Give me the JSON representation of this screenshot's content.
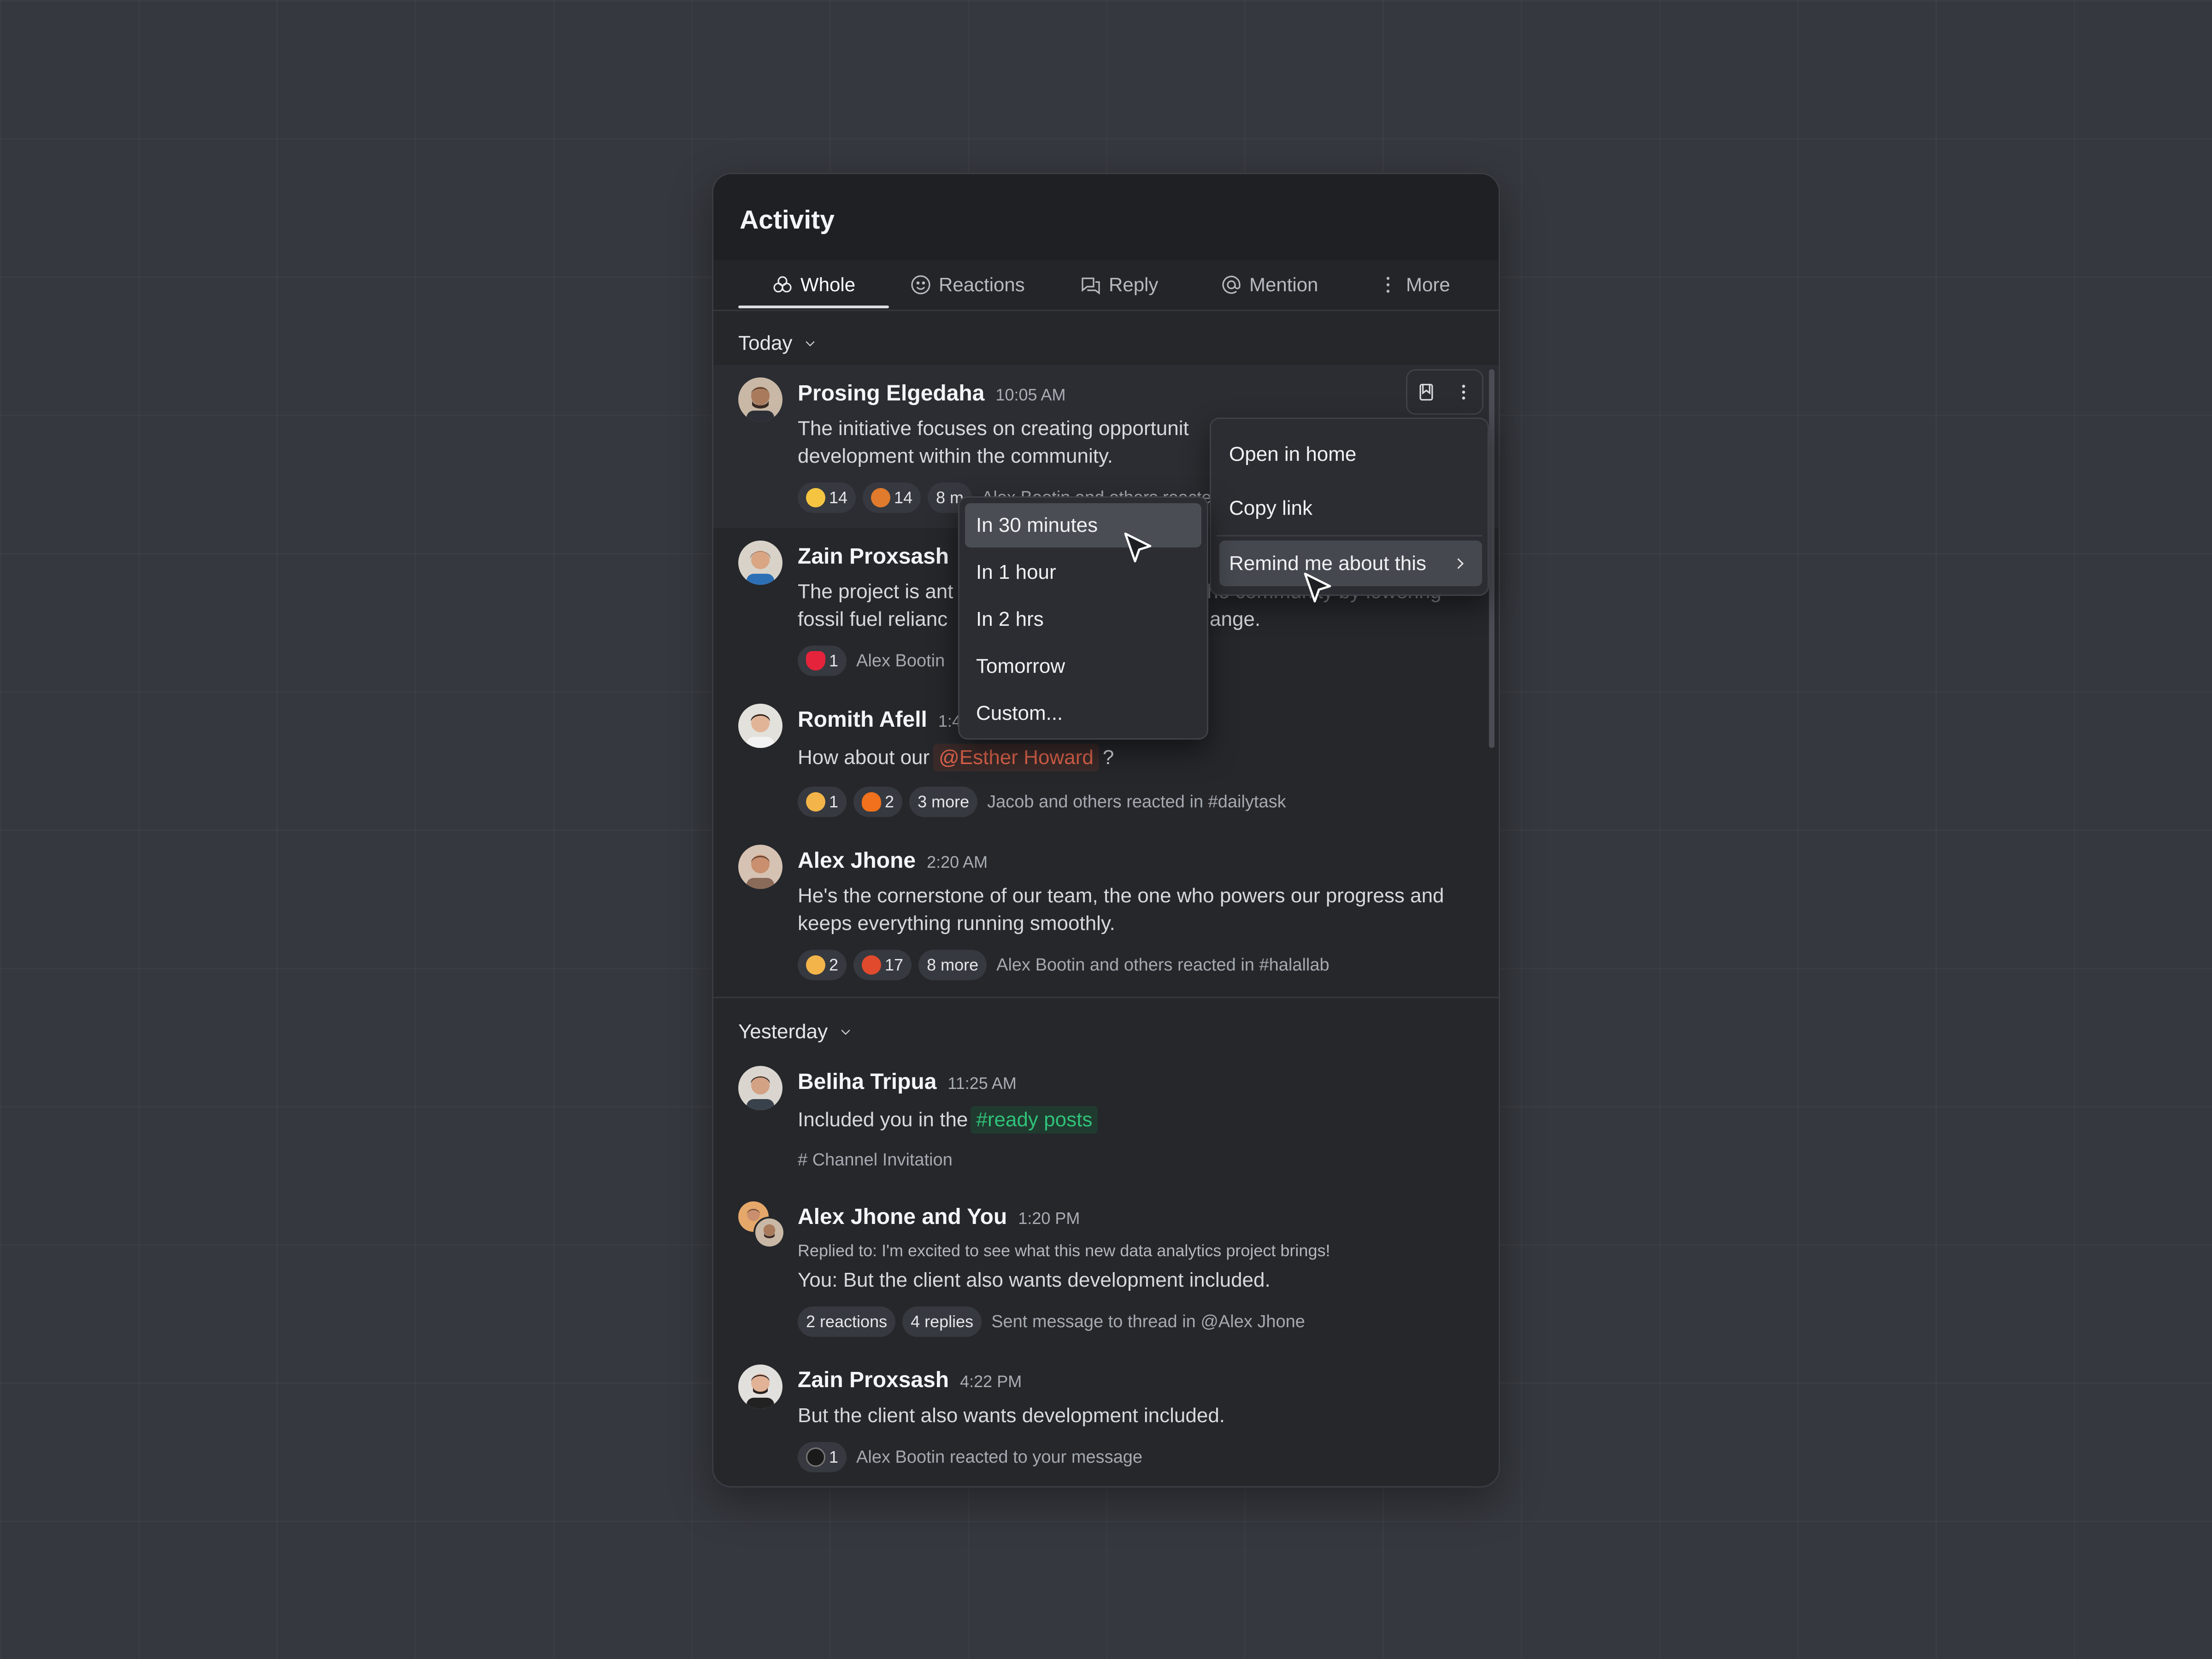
{
  "panel": {
    "title": "Activity",
    "tabs": [
      {
        "label": "Whole",
        "icon": "whole-icon",
        "active": true
      },
      {
        "label": "Reactions",
        "icon": "smile-icon"
      },
      {
        "label": "Reply",
        "icon": "reply-icon"
      },
      {
        "label": "Mention",
        "icon": "at-icon"
      },
      {
        "label": "More",
        "icon": "kebab-icon"
      }
    ]
  },
  "sections": {
    "today": "Today",
    "yesterday": "Yesterday"
  },
  "items": [
    {
      "name": "Prosing Elgedaha",
      "time": "10:05 AM",
      "line1": "The initiative focuses on creating opportunit",
      "line2": "development within the community.",
      "chips": [
        "14",
        "14",
        "8 m"
      ],
      "note": "Alex Bootin and others reacted in #"
    },
    {
      "name": "Zain Proxsash",
      "line1a": "The project is ant",
      "line1b": "the community by lowering",
      "line2a": "fossil fuel relianc",
      "line2b": "ange.",
      "chips": [
        "1"
      ],
      "note": "Alex Bootin"
    },
    {
      "name": "Romith Afell",
      "time": "1:4",
      "text_before": "How about our",
      "mention": "@Esther Howard",
      "text_after": "?",
      "chips": [
        "1",
        "2",
        "3 more"
      ],
      "note": "Jacob and others reacted in #dailytask"
    },
    {
      "name": "Alex Jhone",
      "time": "2:20 AM",
      "line1": "He's the cornerstone of our team, the one who powers our progress and",
      "line2": "keeps everything running smoothly.",
      "chips": [
        "2",
        "17",
        "8 more"
      ],
      "note": "Alex Bootin and others reacted in #halallab"
    },
    {
      "name": "Beliha Tripua",
      "time": "11:25 AM",
      "text_before": "Included you in the",
      "channel": "#ready posts",
      "sub": "# Channel Invitation"
    },
    {
      "name": "Alex Jhone and You",
      "time": "1:20 PM",
      "reply_note": "Replied to:  I'm excited to see what this new data analytics project brings!",
      "text": "You:  But the client also wants development included.",
      "chips": [
        "2 reactions",
        "4 replies"
      ],
      "note": "Sent message to thread in @Alex Jhone"
    },
    {
      "name": "Zain Proxsash",
      "time": "4:22 PM",
      "text": "But the client also wants development included.",
      "chips": [
        "1"
      ],
      "note": "Alex Bootin reacted to your message"
    }
  ],
  "context_menu": {
    "open_in_home": "Open in home",
    "copy_link": "Copy link",
    "remind": "Remind me about this"
  },
  "submenu": [
    "In 30 minutes",
    "In 1 hour",
    "In 2 hrs",
    "Tomorrow",
    "Custom..."
  ],
  "colors": {
    "mention": "#e0644c",
    "channel": "#2fc27a",
    "panel_bg": "#25272b",
    "page_bg": "#35383e"
  }
}
